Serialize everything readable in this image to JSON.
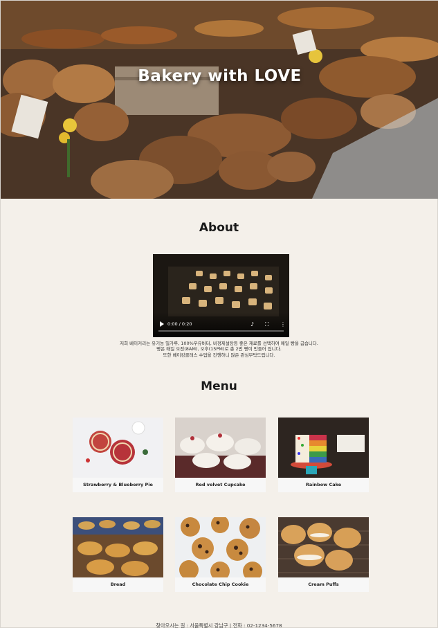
{
  "hero": {
    "title": "Bakery with LOVE"
  },
  "about": {
    "heading": "About",
    "video": {
      "time": "0:00 / 0:20"
    },
    "lines": [
      "저희 베이커리는 유기농 밀가루, 100%우유버터, 비정제설탕등 좋은 재료를 선택하여 매일 빵을 굽습니다.",
      "빵은 매일 오전(8AM), 오후(15PM)로 총 2번 빵이 만들어 집니다.",
      "또한 베이킹클래스 수업을 진행하니 많은 관심부탁드립니다."
    ]
  },
  "menu": {
    "heading": "Menu",
    "items": [
      {
        "label": "Strawberry & Blueberry Pie"
      },
      {
        "label": "Red velvet Cupcake"
      },
      {
        "label": "Rainbow Cake"
      },
      {
        "label": "Bread"
      },
      {
        "label": "Chocolate Chip Cookie"
      },
      {
        "label": "Cream Puffs"
      }
    ]
  },
  "footer": {
    "text": "찾아오시는 길 : 서울특별시 강남구 | 전화 : 02-1234-5678"
  },
  "colors": {
    "background": "#f4f0ea",
    "card": "#f7f7f7",
    "heading": "#1a1a1a"
  }
}
